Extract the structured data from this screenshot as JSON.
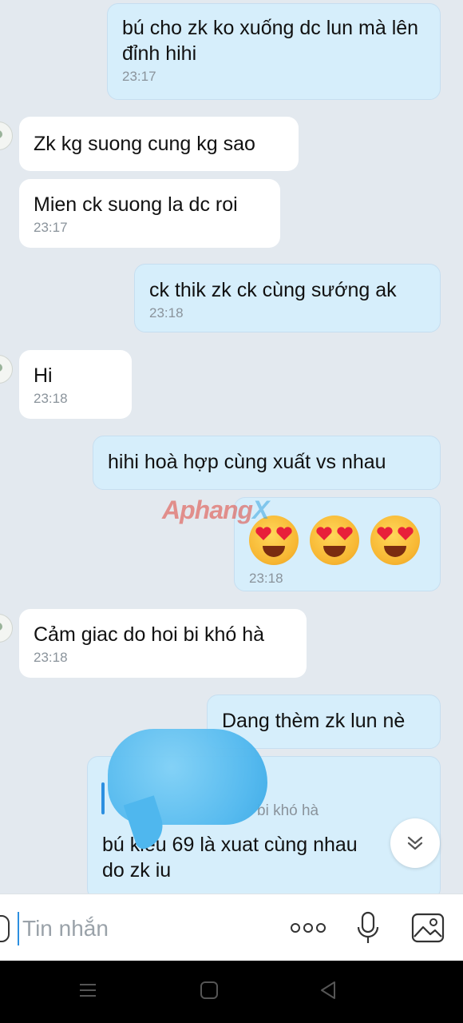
{
  "messages": [
    {
      "dir": "out",
      "text": "bú cho zk ko xuống dc lun mà lên đỉnh hihi",
      "time": "23:17"
    },
    {
      "dir": "in",
      "text": "Zk kg suong cung kg sao"
    },
    {
      "dir": "in",
      "text": "Mien ck suong la dc roi",
      "time": "23:17"
    },
    {
      "dir": "out",
      "text": "ck thik zk ck cùng sướng ak",
      "time": "23:18"
    },
    {
      "dir": "in",
      "text": "Hi",
      "time": "23:18"
    },
    {
      "dir": "out",
      "text": "hihi hoà hợp cùng xuất vs nhau"
    },
    {
      "dir": "out",
      "emojis": [
        "heart-eyes-emoji",
        "heart-eyes-emoji",
        "heart-eyes-emoji"
      ],
      "time": "23:18"
    },
    {
      "dir": "in",
      "text": "Cảm giac do hoi bi khó hà",
      "time": "23:18"
    },
    {
      "dir": "out",
      "text": "Dang thèm zk lun nè"
    },
    {
      "dir": "out",
      "quote": "bi khó hà",
      "text1": "bú kiểu 69 là xuat cùng nhau",
      "text2": "do zk iu"
    }
  ],
  "watermark": {
    "main": "Aphang",
    "accent": "X"
  },
  "composer": {
    "placeholder": "Tin nhắn"
  },
  "icons": {
    "more": "more-dots-icon",
    "mic": "microphone-icon",
    "image": "image-icon",
    "scroll": "double-chevron-down-icon",
    "nav": [
      "menu-icon",
      "home-square-icon",
      "back-triangle-icon"
    ]
  },
  "colors": {
    "out_bubble": "#d6eefb",
    "in_bubble": "#ffffff",
    "background": "#e3e9ef",
    "accent": "#2c8fe0"
  }
}
